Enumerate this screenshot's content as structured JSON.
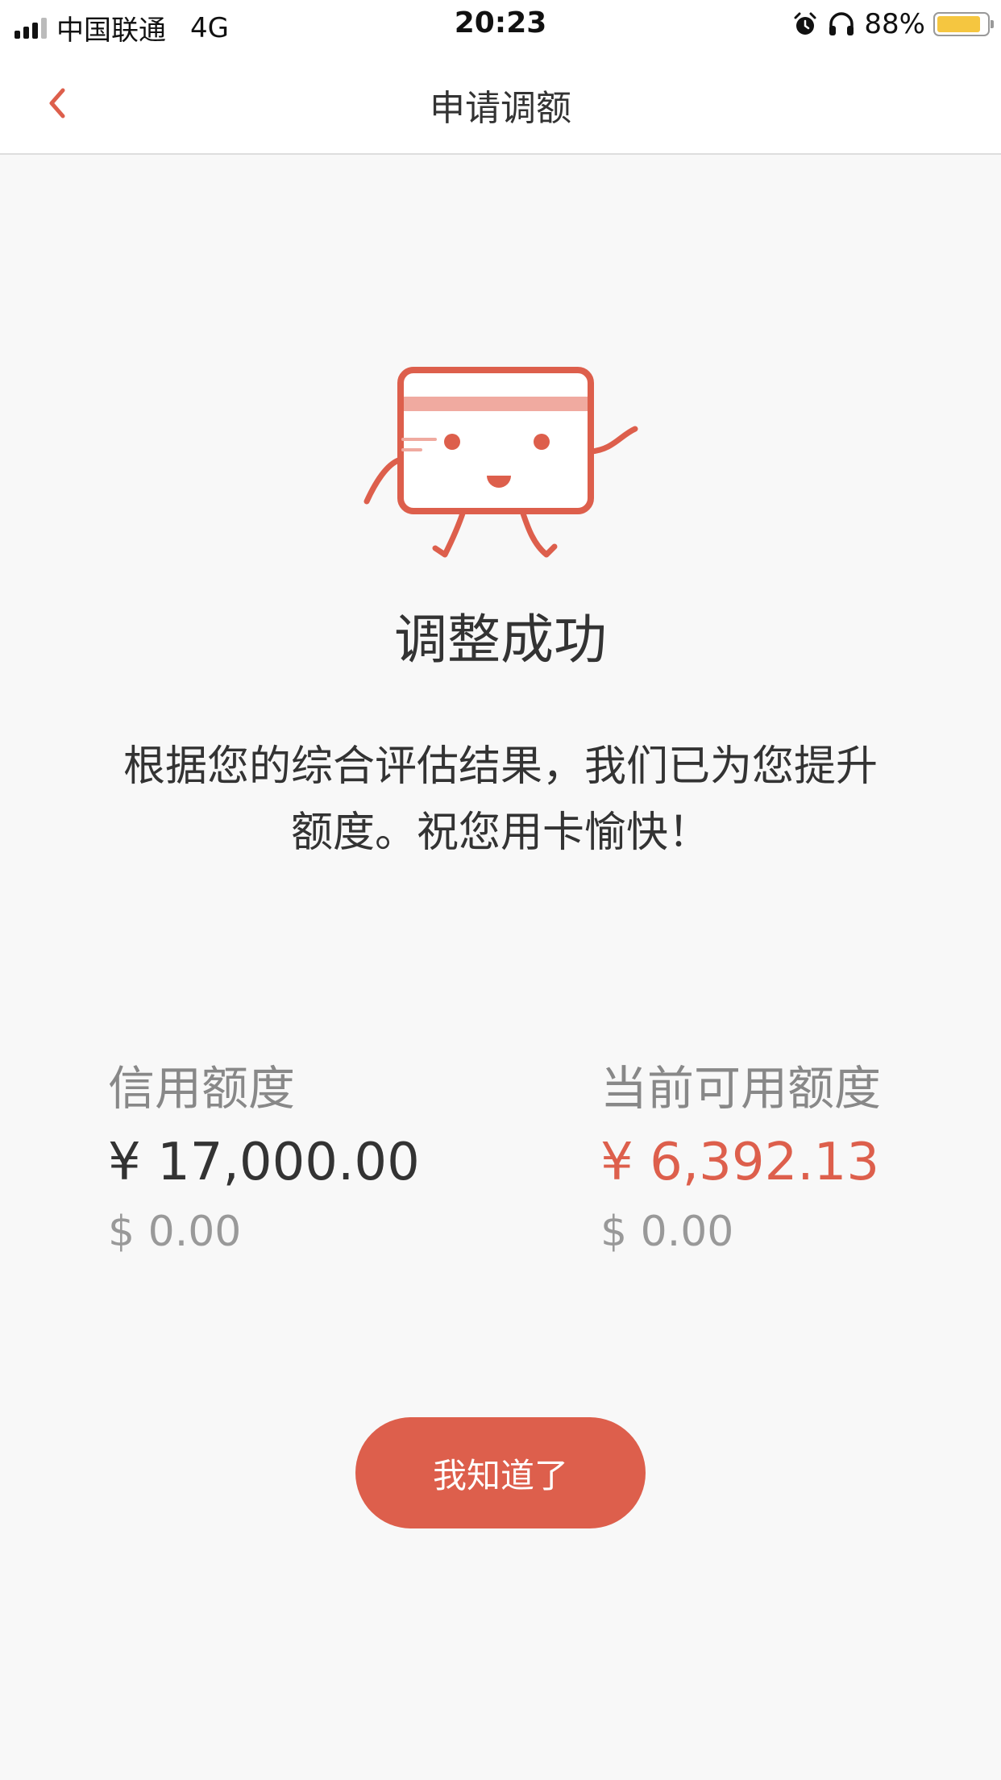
{
  "status_bar": {
    "carrier": "中国联通",
    "network": "4G",
    "time": "20:23",
    "battery": "88%",
    "battery_color": "#f5c640",
    "icons": [
      "signal-icon",
      "alarm-icon",
      "headphones-icon",
      "battery-icon"
    ]
  },
  "nav": {
    "title": "申请调额",
    "back_icon": "chevron-left-icon"
  },
  "result": {
    "title": "调整成功",
    "message": "根据您的综合评估结果，我们已为您提升额度。祝您用卡愉快！"
  },
  "credit_limit": {
    "label": "信用额度",
    "cny": "¥ 17,000.00",
    "usd": "$ 0.00"
  },
  "available_limit": {
    "label": "当前可用额度",
    "cny": "¥ 6,392.13",
    "usd": "$ 0.00"
  },
  "button": {
    "label": "我知道了"
  },
  "colors": {
    "accent": "#dd5f4c",
    "background": "#f8f8f8",
    "text": "#333333",
    "muted": "#888888"
  }
}
